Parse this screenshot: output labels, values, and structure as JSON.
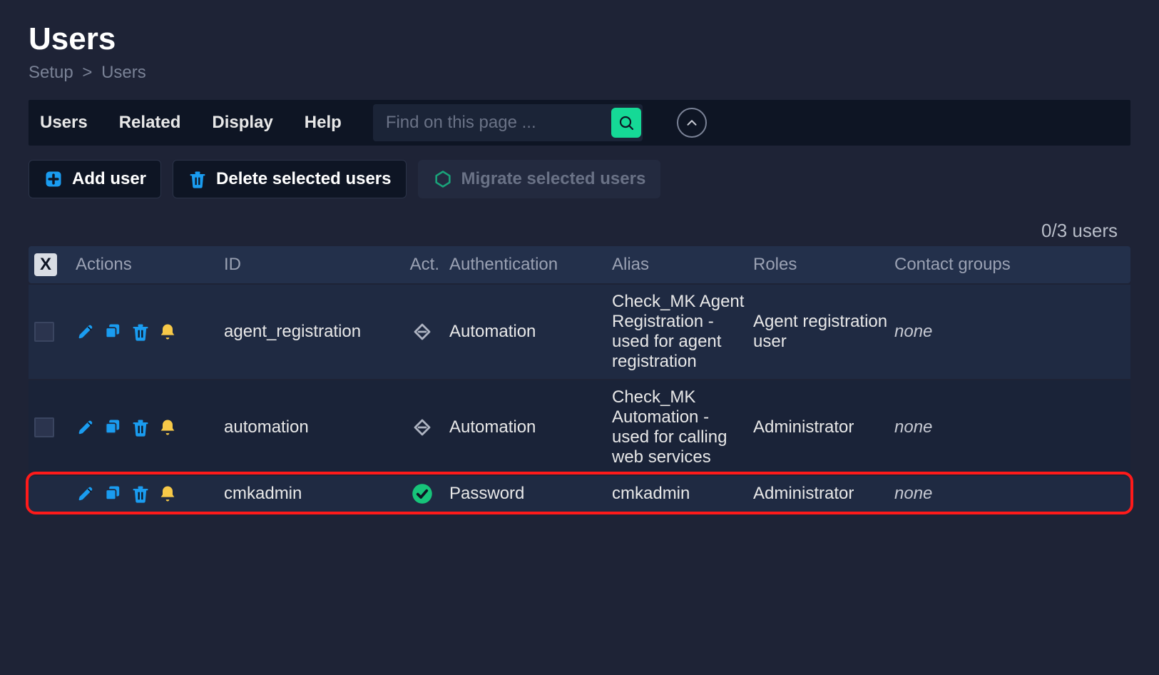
{
  "header": {
    "title": "Users",
    "breadcrumb": [
      "Setup",
      "Users"
    ]
  },
  "menubar": {
    "items": [
      "Users",
      "Related",
      "Display",
      "Help"
    ],
    "search_placeholder": "Find on this page ..."
  },
  "toolbar": {
    "add_user": "Add user",
    "delete_selected": "Delete selected users",
    "migrate_selected": "Migrate selected users"
  },
  "counter": "0/3 users",
  "table": {
    "select_all": "X",
    "headers": {
      "actions": "Actions",
      "id": "ID",
      "act": "Act.",
      "auth": "Authentication",
      "alias": "Alias",
      "roles": "Roles",
      "cg": "Contact groups"
    },
    "rows": [
      {
        "selectable": true,
        "id": "agent_registration",
        "act": "sync",
        "auth": "Automation",
        "alias": "Check_MK Agent Registration - used for agent registration",
        "roles": "Agent registration user",
        "cg": "none",
        "highlight": false
      },
      {
        "selectable": true,
        "id": "automation",
        "act": "sync",
        "auth": "Automation",
        "alias": "Check_MK Automation - used for calling web services",
        "roles": "Administrator",
        "cg": "none",
        "highlight": false
      },
      {
        "selectable": false,
        "id": "cmkadmin",
        "act": "ok",
        "auth": "Password",
        "alias": "cmkadmin",
        "roles": "Administrator",
        "cg": "none",
        "highlight": true
      }
    ]
  }
}
